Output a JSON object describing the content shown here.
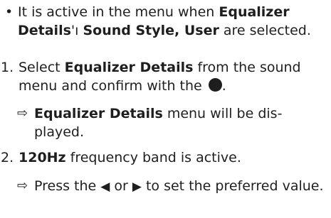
{
  "bullet": {
    "marker": "•",
    "t1": "It is active in the menu when ",
    "b1": "Equalizer Details",
    "t2": "'ı ",
    "b2": "Sound Style, User",
    "t3": " are selected."
  },
  "step1": {
    "number": "1.",
    "t1": "Select ",
    "b1": "Equalizer Details",
    "t2": " from the sound menu and confirm with the ",
    "t3": ".",
    "icon": "ok-button-circle-icon"
  },
  "result1": {
    "marker": "⇨",
    "b1": "Equalizer Details",
    "t1": " menu will be dis-played."
  },
  "step2": {
    "number": "2.",
    "b1": "120Hz",
    "t1": " frequency band is active."
  },
  "result2": {
    "marker": "⇨",
    "t1": "Press the ",
    "left_icon": "◀",
    "t2": " or ",
    "right_icon": "▶",
    "t3": " to set the preferred value."
  }
}
